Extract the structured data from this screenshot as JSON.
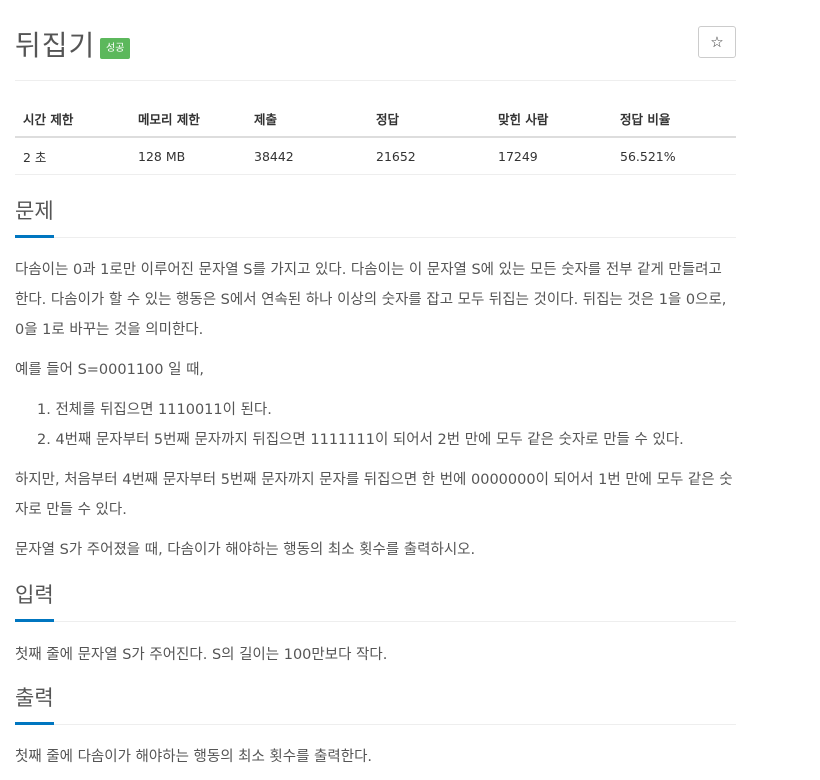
{
  "problem": {
    "title": "뒤집기",
    "badge": "성공",
    "favorite_icon": "star-icon"
  },
  "stats": {
    "headers": [
      "시간 제한",
      "메모리 제한",
      "제출",
      "정답",
      "맞힌 사람",
      "정답 비율"
    ],
    "values": [
      "2 초",
      "128 MB",
      "38442",
      "21652",
      "17249",
      "56.521%"
    ]
  },
  "sections": {
    "description": {
      "heading": "문제",
      "para1": "다솜이는 0과 1로만 이루어진 문자열 S를 가지고 있다. 다솜이는 이 문자열 S에 있는 모든 숫자를 전부 같게 만들려고 한다. 다솜이가 할 수 있는 행동은 S에서 연속된 하나 이상의 숫자를 잡고 모두 뒤집는 것이다. 뒤집는 것은 1을 0으로, 0을 1로 바꾸는 것을 의미한다.",
      "para2": "예를 들어 S=0001100 일 때,",
      "list": [
        "1. 전체를 뒤집으면 1110011이 된다.",
        "2. 4번째 문자부터 5번째 문자까지 뒤집으면 1111111이 되어서 2번 만에 모두 같은 숫자로 만들 수 있다."
      ],
      "para3": "하지만, 처음부터 4번째 문자부터 5번째 문자까지 문자를 뒤집으면 한 번에 0000000이 되어서 1번 만에 모두 같은 숫자로 만들 수 있다.",
      "para4": "문자열 S가 주어졌을 때, 다솜이가 해야하는 행동의 최소 횟수를 출력하시오."
    },
    "input": {
      "heading": "입력",
      "text": "첫째 줄에 문자열 S가 주어진다. S의 길이는 100만보다 작다."
    },
    "output": {
      "heading": "출력",
      "text": "첫째 줄에 다솜이가 해야하는 행동의 최소 횟수를 출력한다."
    }
  }
}
